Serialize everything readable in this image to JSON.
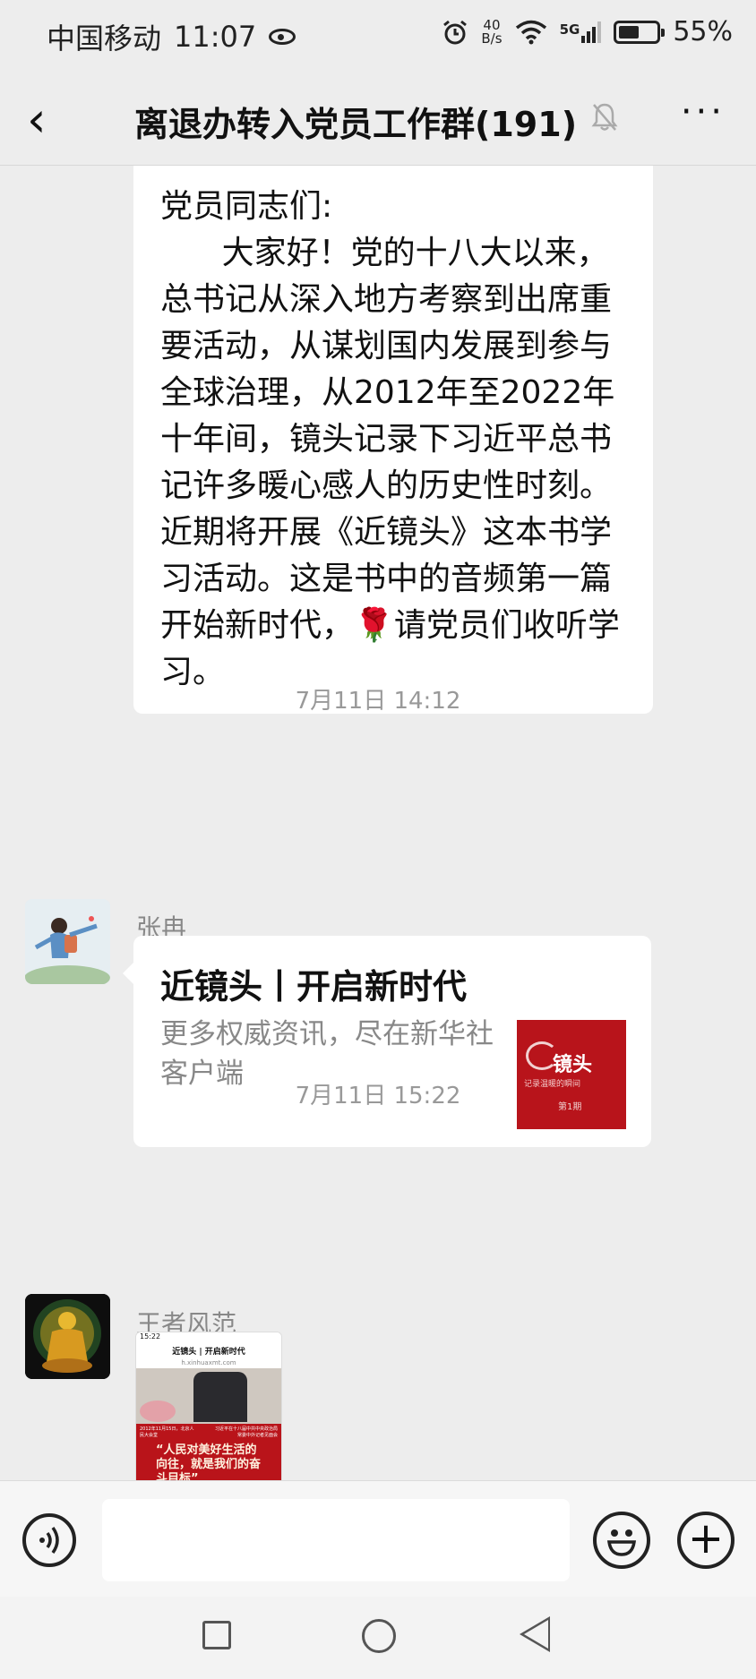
{
  "status_bar": {
    "carrier": "中国移动",
    "time": "11:07",
    "net_speed_value": "40",
    "net_speed_unit": "B/s",
    "signal": "5G",
    "battery_text": "55%",
    "battery_level": 0.55
  },
  "header": {
    "back_glyph": "‹",
    "title": "离退办转入党员工作群(191)",
    "mute_glyph": "🔕",
    "more_glyph": "···"
  },
  "messages": {
    "notice_text": "党员同志们:\n      大家好！党的十八大以来，总书记从深入地方考察到出席重要活动，从谋划国内发展到参与全球治理，从2012年至2022年十年间，镜头记录下习近平总书记许多暖心感人的历史性时刻。\n近期将开展《近镜头》这本书学习活动。这是书中的音频第一篇开始新时代，🌹请党员们收听学习。",
    "timestamp1": "7月11日 14:12",
    "sender1": "张冉",
    "link_title": "近镜头丨开启新时代",
    "link_desc": "更多权威资讯，尽在新华社客户端",
    "thumb_title": "镜头",
    "thumb_sub": "记录温暖的瞬间",
    "thumb_episode": "第1期",
    "timestamp2": "7月11日 15:22",
    "sender2": "王者风范",
    "img_status_time": "15:22",
    "img_title": "近镜头 | 开启新时代",
    "img_url": "h.xinhuaxmt.com",
    "img_caption_left": "2012年11月15日，北京人民大会堂",
    "img_caption_right": "习近平在十八届中共中央政治局常委中外记者见面会",
    "img_quote": "“人民对美好生活的向往，就是我们的奋斗目标”"
  },
  "input_bar": {
    "voice_icon": "voice-icon",
    "emoji_icon": "emoji-icon",
    "plus_glyph": "+"
  }
}
